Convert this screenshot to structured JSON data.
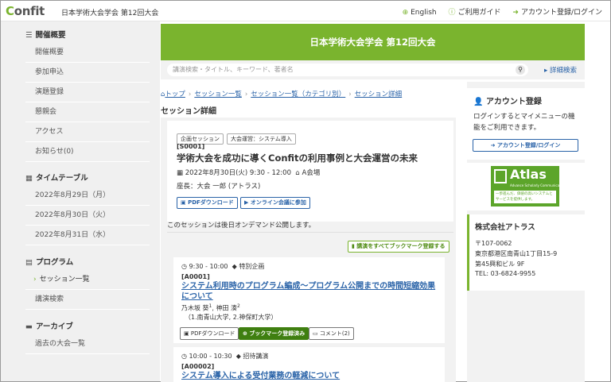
{
  "header": {
    "logo_prefix": "C",
    "logo_suffix": "onfit",
    "site_title": "日本学術大会学会 第12回大会",
    "links": [
      "English",
      "ご利用ガイド",
      "アカウント登録/ログイン"
    ]
  },
  "sidebar": {
    "sections": [
      {
        "title": "開催概要",
        "items": [
          "開催概要",
          "参加申込",
          "演題登録",
          "懇親会",
          "アクセス",
          "お知らせ(0)"
        ]
      },
      {
        "title": "タイムテーブル",
        "items": [
          "2022年8月29日（月）",
          "2022年8月30日（火）",
          "2022年8月31日（水）"
        ]
      },
      {
        "title": "プログラム",
        "items": [
          "セッション一覧",
          "講演検索"
        ]
      },
      {
        "title": "アーカイブ",
        "items": [
          "過去の大会一覧"
        ]
      }
    ]
  },
  "banner": {
    "title": "日本学術大会学会 第12回大会"
  },
  "search": {
    "placeholder": "講演検索・タイトル、キーワード、著者名",
    "advanced": "詳細検索"
  },
  "breadcrumb": [
    "トップ",
    "セッション一覧",
    "セッション一覧（カテゴリ別）",
    "セッション詳細"
  ],
  "section_title": "セッション詳細",
  "session": {
    "tags": [
      "企画セッション",
      "大会運営：システム導入"
    ],
    "id": "[S0001]",
    "title": "学術大会を成功に導くConfitの利用事例と大会運営の未来",
    "datetime": "2022年8月30日(火) 9:30 - 12:00",
    "room": "A会場",
    "chair": "座長：大会 一郎 (アトラス)",
    "btn_pdf": "PDFダウンロード",
    "btn_online": "オンライン会議に参加",
    "note": "このセッションは後日オンデマンド公開します。",
    "bookmark_all": "講演をすべてブックマーク登録する"
  },
  "presentations": [
    {
      "time": "9:30 - 10:00",
      "kind": "特別企画",
      "id": "[A0001]",
      "title": "システム利用時のプログラム編成～プログラム公開までの時間短縮効果について",
      "authors": "乃木坂 葵",
      "authors2": "神田 湊",
      "sup1": "1",
      "sup2": "2",
      "affil": "（1.南青山大学, 2.神保町大学）",
      "btn_pdf": "PDFダウンロード",
      "btn_bookmark": "ブックマーク登録済み",
      "btn_comment": "コメント(2)"
    },
    {
      "time": "10:00 - 10:30",
      "kind": "招待講演",
      "id": "[A00002]",
      "title": "システム導入による受付業務の軽減について"
    }
  ],
  "account": {
    "title": "アカウント登録",
    "text": "ログインするとマイメニューの機能をご利用できます。",
    "button": "アカウント登録/ログイン"
  },
  "sponsor": {
    "name": "Atlas",
    "sub": "Advance Scholarly Communications",
    "tagline": "一歩進んだ、価値の高いシステムとサービスを提供します。"
  },
  "company": {
    "name": "株式会社アトラス",
    "postal": "〒107-0062",
    "address1": "東京都港区南青山1丁目15-9",
    "address2": "第45興和ビル 9F",
    "tel": "TEL: 03-6824-9955"
  }
}
